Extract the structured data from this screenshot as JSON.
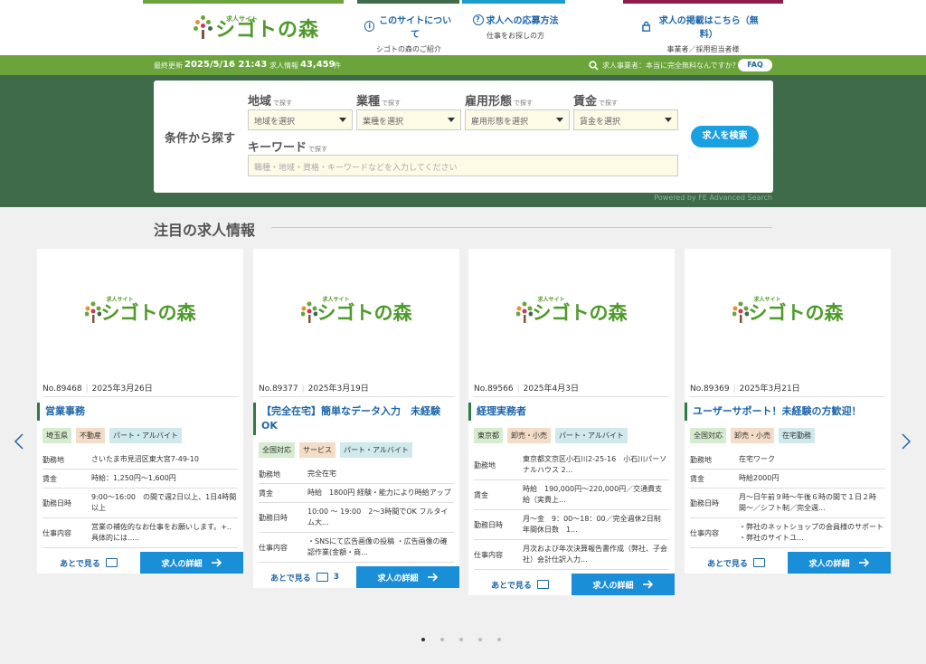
{
  "header": {
    "logo_small": "求人サイト",
    "logo_main": "シゴトの森",
    "nav": [
      {
        "title": "このサイトについて",
        "sub": "シゴトの森のご紹介",
        "icon": "info-icon"
      },
      {
        "title": "求人への応募方法",
        "sub": "仕事をお探しの方",
        "icon": "help-icon"
      },
      {
        "title": "求人の掲載はこちら（無料）",
        "sub": "事業者／採用担当者様",
        "icon": "lock-icon"
      }
    ],
    "colors": {
      "green": "#6aa43a",
      "dark_green": "#3f6b4a",
      "teal": "#1a9ec9",
      "wine": "#8e1d4b",
      "blue": "#1d65a8"
    }
  },
  "infobar": {
    "updated_label": "最終更新",
    "updated_value": "2025/5/16 21:43",
    "count_label": "求人情報",
    "count_value": "43,459",
    "count_unit": "件",
    "question": "求人事業者：本当に完全無料なんですか？",
    "faq": "FAQ"
  },
  "search": {
    "heading": "条件から探す",
    "filters": [
      {
        "label": "地域",
        "hint": "で探す",
        "value": "地域を選択"
      },
      {
        "label": "業種",
        "hint": "で探す",
        "value": "業種を選択"
      },
      {
        "label": "雇用形態",
        "hint": "で探す",
        "value": "雇用形態を選択"
      },
      {
        "label": "賃金",
        "hint": "で探す",
        "value": "賃金を選択"
      }
    ],
    "keyword_label": "キーワード",
    "keyword_hint": "で探す",
    "keyword_placeholder": "職種・地域・資格・キーワードなどを入力してください",
    "button": "求人を検索",
    "powered": "Powered by FE Advanced Search"
  },
  "section": {
    "title": "注目の求人情報"
  },
  "cards": [
    {
      "no": "No.89468",
      "date": "2025年3月26日",
      "title": "営業事務",
      "tags": [
        "埼玉県",
        "不動産",
        "パート・アルバイト"
      ],
      "rows": [
        {
          "k": "勤務地",
          "v": "さいたま市見沼区東大宮7-49-10"
        },
        {
          "k": "賃金",
          "v": "時給：1,250円〜1,600円"
        },
        {
          "k": "勤務日時",
          "v": "9:00〜16:00　の間で週2日以上、1日4時間以上"
        },
        {
          "k": "仕事内容",
          "v": "営業の補佐的なお仕事をお願いします。+..具体的には….."
        }
      ],
      "later": "あとで見る",
      "later_count": "",
      "detail": "求人の詳細"
    },
    {
      "no": "No.89377",
      "date": "2025年3月19日",
      "title": "【完全在宅】簡単なデータ入力　未経験OK",
      "tags": [
        "全国対応",
        "サービス",
        "パート・アルバイト"
      ],
      "rows": [
        {
          "k": "勤務地",
          "v": "完全在宅"
        },
        {
          "k": "賃金",
          "v": "時給　1800円 経験・能力により時給アップ"
        },
        {
          "k": "勤務日時",
          "v": "10:00 〜 19:00　2〜3時間でOK フルタイム大..."
        },
        {
          "k": "仕事内容",
          "v": "・SNSにて広告画像の投稿 ・広告画像の確認作業(金額・商..."
        }
      ],
      "later": "あとで見る",
      "later_count": "3",
      "detail": "求人の詳細"
    },
    {
      "no": "No.89566",
      "date": "2025年4月3日",
      "title": "経理実務者",
      "tags": [
        "東京都",
        "卸売・小売",
        "パート・アルバイト"
      ],
      "rows": [
        {
          "k": "勤務地",
          "v": "東京都文京区小石川2-25-16　小石川パーソナルハウス 2..."
        },
        {
          "k": "賃金",
          "v": "時給　190,000円〜220,000円／交通費支給（実費上..."
        },
        {
          "k": "勤務日時",
          "v": "月〜金　9：00〜18：00／完全週休2日制　年間休日数　1..."
        },
        {
          "k": "仕事内容",
          "v": "月次および年次決算報告書作成（弊社、子会社）会計仕訳入力..."
        }
      ],
      "later": "あとで見る",
      "later_count": "",
      "detail": "求人の詳細"
    },
    {
      "no": "No.89369",
      "date": "2025年3月21日",
      "title": "ユーザーサポート！未経験の方歓迎！",
      "tags": [
        "全国対応",
        "卸売・小売",
        "在宅勤務"
      ],
      "rows": [
        {
          "k": "勤務地",
          "v": "在宅ワーク"
        },
        {
          "k": "賃金",
          "v": "時給2000円"
        },
        {
          "k": "勤務日時",
          "v": "月〜日午前９時〜午後６時の間で１日２時間〜／シフト制／完全週..."
        },
        {
          "k": "仕事内容",
          "v": "・弊社のネットショップの会員様のサポート ・弊社のサイトユ..."
        }
      ],
      "later": "あとで見る",
      "later_count": "",
      "detail": "求人の詳細"
    }
  ],
  "carousel": {
    "pages": 5,
    "current": 1
  }
}
